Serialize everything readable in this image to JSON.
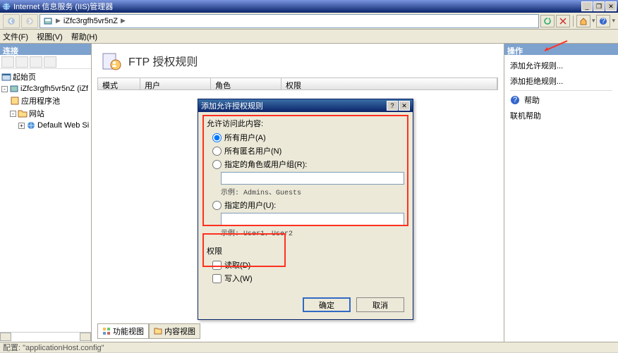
{
  "window": {
    "title": "Internet 信息服务 (IIS)管理器"
  },
  "breadcrumb": {
    "node": "iZfc3rgfh5vr5nZ"
  },
  "menu": {
    "file": "文件(F)",
    "view": "视图(V)",
    "help": "帮助(H)"
  },
  "left": {
    "header": "连接",
    "start": "起始页",
    "server": "iZfc3rgfh5vr5nZ (iZf",
    "apppool": "应用程序池",
    "sites": "网站",
    "default_site": "Default Web Si"
  },
  "center": {
    "title": "FTP 授权规则",
    "cols": {
      "mode": "模式",
      "users": "用户",
      "roles": "角色",
      "perms": "权限"
    },
    "tabs": {
      "features": "功能视图",
      "content": "内容视图"
    }
  },
  "right": {
    "header": "操作",
    "add_allow": "添加允许规则...",
    "add_deny": "添加拒绝规则...",
    "help": "帮助",
    "online_help": "联机帮助"
  },
  "dialog": {
    "title": "添加允许授权规则",
    "access_label": "允许访问此内容:",
    "opt_all": "所有用户(A)",
    "opt_anon": "所有匿名用户(N)",
    "opt_roles": "指定的角色或用户组(R):",
    "example_roles": "示例: Admins、Guests",
    "opt_users": "指定的用户(U):",
    "example_users": "示例: User1、User2",
    "perm_label": "权限",
    "perm_read": "读取(D)",
    "perm_write": "写入(W)",
    "ok": "确定",
    "cancel": "取消",
    "help_q": "?"
  },
  "status": {
    "text": "配置: \"applicationHost.config\""
  }
}
